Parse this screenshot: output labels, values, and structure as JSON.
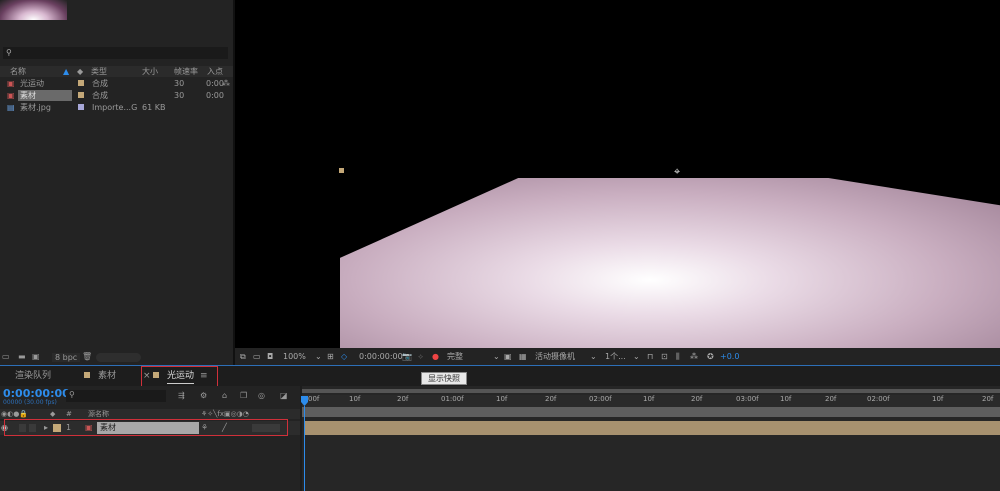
{
  "project": {
    "search_icon": "search-icon",
    "columns": [
      "名称",
      "类型",
      "大小",
      "帧速率",
      "入点"
    ],
    "items": [
      {
        "name": "光运动",
        "type": "合成",
        "size": "",
        "fps": "30",
        "in": "0:00",
        "color": "#c4a878"
      },
      {
        "name": "素材",
        "type": "合成",
        "size": "",
        "fps": "30",
        "in": "0:00",
        "color": "#c4a878"
      },
      {
        "name": "素材.jpg",
        "type": "Importe...G",
        "size": "61 KB",
        "fps": "",
        "in": "",
        "color": "#a8a8d8"
      }
    ],
    "bpc": "8 bpc"
  },
  "viewer_toolbar": {
    "zoom": "100%",
    "timecode": "0:00:00:00",
    "resolution": "完整",
    "camera": "活动摄像机",
    "views": "1个...",
    "exposure": "+0.0"
  },
  "tooltip": "显示快照",
  "tabs": [
    "渲染队列",
    "素材",
    "光运动"
  ],
  "timeline": {
    "timecode": "0:00:00:00",
    "sub_timecode": "00000 (30.00 fps)",
    "layer_header": "源名称",
    "layer": {
      "index": "1",
      "name": "素材"
    },
    "ruler": [
      "00f",
      "10f",
      "20f",
      "01:00f",
      "10f",
      "20f",
      "02:00f",
      "10f",
      "20f",
      "03:00f",
      "10f",
      "20f",
      "02:00f",
      "10f",
      "20f"
    ]
  },
  "colors": {
    "accent": "#2d8ceb",
    "highlight": "#d0303a",
    "layer_bar": "#a7916f"
  }
}
